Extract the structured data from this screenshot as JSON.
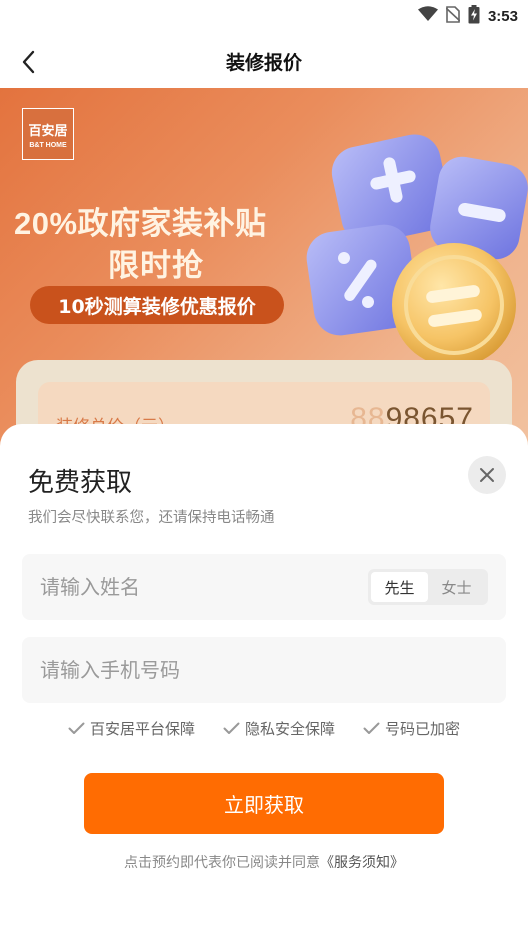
{
  "status_bar": {
    "time": "3:53",
    "icons": [
      "wifi-icon",
      "no-sim-icon",
      "battery-charging-icon"
    ]
  },
  "nav": {
    "title": "装修报价",
    "back_icon": "back-arrow-icon"
  },
  "banner": {
    "logo_cn": "百安居",
    "logo_en": "B&T HOME",
    "promo_pct": "20%",
    "promo_line1_rest": "政府家装补贴",
    "promo_line2": "限时抢",
    "pill_text": "10秒测算装修优惠报价",
    "price_label": "装修总价（元）",
    "price_ghost": "88",
    "price_value": "98657"
  },
  "form": {
    "title": "免费获取",
    "subtitle": "我们会尽快联系您，还请保持电话畅通",
    "close_icon": "close-icon",
    "name_placeholder": "请输入姓名",
    "name_value": "",
    "gender_options": [
      "先生",
      "女士"
    ],
    "gender_selected": "先生",
    "phone_placeholder": "请输入手机号码",
    "phone_value": "",
    "guarantees": [
      "百安居平台保障",
      "隐私安全保障",
      "号码已加密"
    ],
    "submit_label": "立即获取",
    "agreement_prefix": "点击预约即代表你已阅读并同意",
    "agreement_link": "《服务须知》"
  },
  "colors": {
    "accent": "#ff6c02",
    "banner_start": "#e3733e",
    "banner_end": "#f2c7a6"
  }
}
